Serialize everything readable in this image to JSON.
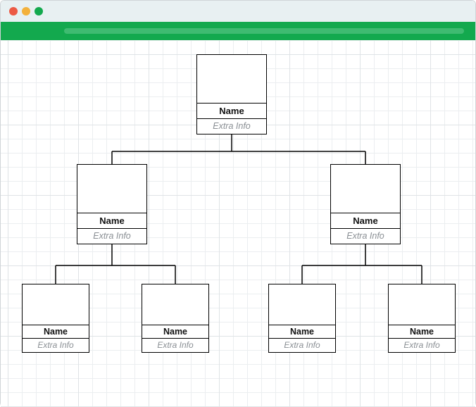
{
  "window": {
    "traffic_buttons": [
      "close",
      "minimize",
      "zoom"
    ]
  },
  "colors": {
    "toolbar": "#13a94e",
    "toolbar_track": "#3fbb71",
    "titlebar": "#e8f0f2",
    "grid_minor": "#ebeef0",
    "grid_major": "#dfe3e6",
    "node_border": "#000000",
    "extra_text": "#8a8f94"
  },
  "chart": {
    "type": "org-chart",
    "root": {
      "name_label": "Name",
      "extra_label": "Extra Info",
      "children": [
        {
          "id": "mid_left",
          "name_label": "Name",
          "extra_label": "Extra Info",
          "children": [
            {
              "id": "leaf1",
              "name_label": "Name",
              "extra_label": "Extra Info"
            },
            {
              "id": "leaf2",
              "name_label": "Name",
              "extra_label": "Extra Info"
            }
          ]
        },
        {
          "id": "mid_right",
          "name_label": "Name",
          "extra_label": "Extra Info",
          "children": [
            {
              "id": "leaf3",
              "name_label": "Name",
              "extra_label": "Extra Info"
            },
            {
              "id": "leaf4",
              "name_label": "Name",
              "extra_label": "Extra Info"
            }
          ]
        }
      ]
    }
  }
}
